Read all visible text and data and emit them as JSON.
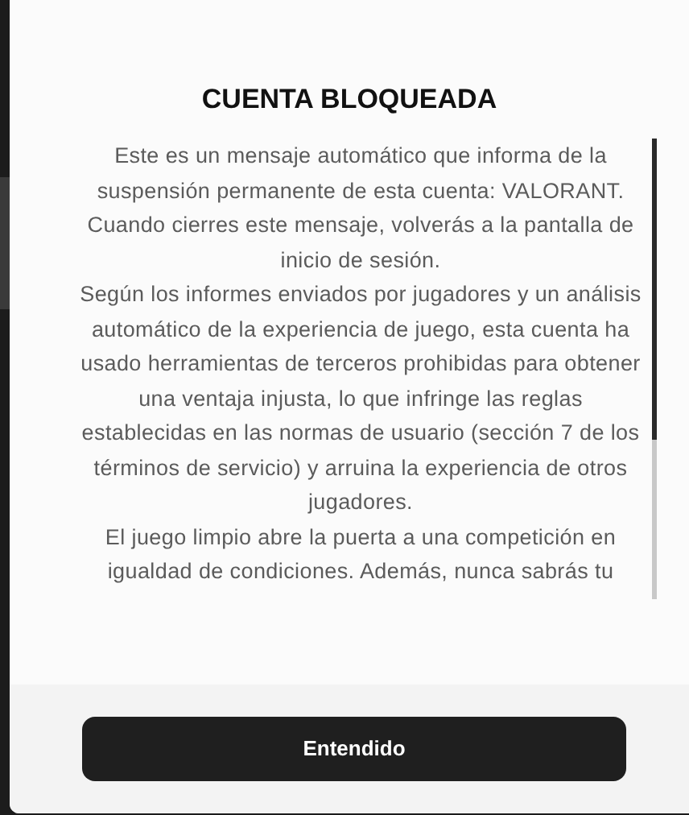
{
  "dialog": {
    "title": "CUENTA BLOQUEADA",
    "paragraphs": [
      "Este es un mensaje automático que informa de la suspensión permanente de esta cuenta: VALORANT. Cuando cierres este mensaje, volverás a la pantalla de inicio de sesión.",
      "Según los informes enviados por jugadores y un análisis automático de la experiencia de juego, esta cuenta ha usado herramientas de terceros prohibidas para obtener una ventaja injusta, lo que infringe las reglas establecidas en las normas de usuario (sección 7 de los términos de servicio) y arruina la experiencia de otros jugadores.",
      "El juego limpio abre la puerta a una competición en igualdad de condiciones. Además, nunca sabrás tu"
    ],
    "button": "Entendido"
  }
}
